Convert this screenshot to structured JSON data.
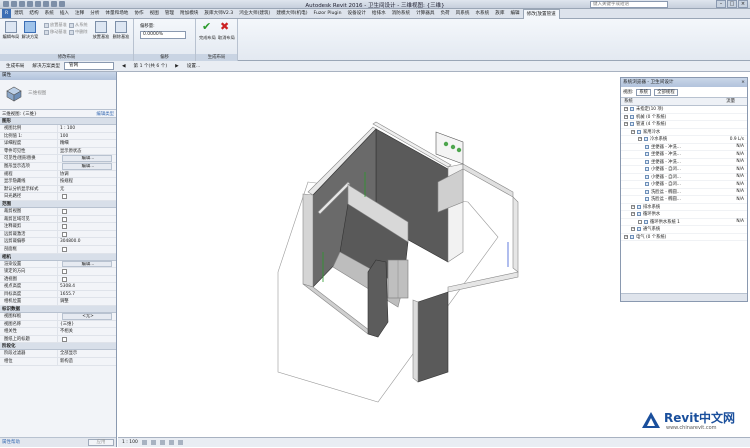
{
  "titlebar": {
    "app_title": "Autodesk Revit 2016 -   卫生间设计 - 三维视图: {三维}",
    "search_placeholder": "键入关键字或短语"
  },
  "tabs": [
    "建筑",
    "结构",
    "系统",
    "插入",
    "注释",
    "分析",
    "体量和场地",
    "协作",
    "视图",
    "管理",
    "附加模块",
    "族库大师V2.3",
    "鸿业大师(建筑)",
    "建模大师(机电)",
    "Fuzor Plugin",
    "设备设计",
    "给排水",
    "消防系统",
    "计算器具",
    "负荷",
    "风系统",
    "水系统",
    "族库",
    "编辑",
    "修改|放置管道"
  ],
  "ribbon": {
    "btn_edit": "编辑布局",
    "btn_solution": "解决方案",
    "btn_place_base": "放置基准",
    "btn_move_base": "移动基准",
    "btn_from_system": "从系统",
    "btn_to_center": "中删除",
    "btn_place": "放置基准",
    "btn_remove": "删除基准",
    "btn_modify": "修改",
    "btn_offset_label": "偏移量:",
    "offset_value": "0.0000%",
    "btn_finish": "完成布局",
    "btn_cancel": "取消布局",
    "panel_modify": "修改布局",
    "panel_offset": "偏移",
    "panel_generate": "生成布局"
  },
  "optionbar": {
    "generate_layout": "生成布局",
    "solution_type": "解决方案类型",
    "solution_value": "管网",
    "views": "第 1 个(共 6 个)",
    "settings": "设置..."
  },
  "properties": {
    "header": "属性",
    "type_name": "三维视图",
    "filter_label": "三维视图: {三维}",
    "edit_type": "编辑类型",
    "sections": [
      {
        "title": "图形",
        "rows": [
          [
            "视图比例",
            "1 : 100"
          ],
          [
            "比例值 1:",
            "100"
          ],
          [
            "详细程度",
            "精细"
          ],
          [
            "零件可见性",
            "显示原状态"
          ],
          [
            "可见性/图形替换",
            "编辑..."
          ],
          [
            "图形显示选项",
            "编辑..."
          ],
          [
            "规程",
            "协调"
          ],
          [
            "显示隐藏线",
            "按规程"
          ],
          [
            "默认分析显示样式",
            "无"
          ],
          [
            "日光路径",
            ""
          ]
        ]
      },
      {
        "title": "范围",
        "rows": [
          [
            "裁剪视图",
            ""
          ],
          [
            "裁剪区域可见",
            ""
          ],
          [
            "注释裁剪",
            ""
          ],
          [
            "远剪裁激活",
            ""
          ],
          [
            "远剪裁偏移",
            "304800.0"
          ],
          [
            "剖面框",
            ""
          ]
        ]
      },
      {
        "title": "相机",
        "rows": [
          [
            "渲染设置",
            "编辑..."
          ],
          [
            "锁定的方向",
            ""
          ],
          [
            "透视图",
            ""
          ],
          [
            "视点高度",
            "5308.4"
          ],
          [
            "目标高度",
            "1655.7"
          ],
          [
            "相机位置",
            "调整"
          ]
        ]
      },
      {
        "title": "标识数据",
        "rows": [
          [
            "视图样板",
            "<无>"
          ],
          [
            "视图名称",
            "{三维}"
          ],
          [
            "相关性",
            "不相关"
          ],
          [
            "图纸上的标题",
            ""
          ]
        ]
      },
      {
        "title": "阶段化",
        "rows": [
          [
            "阶段过滤器",
            "全部显示"
          ],
          [
            "相位",
            "新构造"
          ]
        ]
      }
    ],
    "help_link": "属性帮助",
    "apply": "应用"
  },
  "statusbar": {
    "scale": "1 : 100"
  },
  "system_browser": {
    "title": "系统浏览器 - 卫生间设计",
    "view_label": "视图:",
    "view_value": "系统",
    "filter_value": "全部规程",
    "col_system": "系统",
    "col_flow": "流量",
    "tree": [
      {
        "indent": 0,
        "label": "未指定(10 项)",
        "flow": ""
      },
      {
        "indent": 0,
        "label": "机械 (0 个系统)",
        "flow": ""
      },
      {
        "indent": 0,
        "label": "管道 (4 个系统)",
        "flow": ""
      },
      {
        "indent": 1,
        "label": "家用冷水",
        "flow": ""
      },
      {
        "indent": 2,
        "label": "冷水系统",
        "flow": "0.9 L/s"
      },
      {
        "indent": 3,
        "label": "坐便器 - 冲洗...",
        "flow": "N/A"
      },
      {
        "indent": 3,
        "label": "坐便器 - 冲洗...",
        "flow": "N/A"
      },
      {
        "indent": 3,
        "label": "坐便器 - 冲洗...",
        "flow": "N/A"
      },
      {
        "indent": 3,
        "label": "小便器 - 自闭...",
        "flow": "N/A"
      },
      {
        "indent": 3,
        "label": "小便器 - 自闭...",
        "flow": "N/A"
      },
      {
        "indent": 3,
        "label": "小便器 - 自闭...",
        "flow": "N/A"
      },
      {
        "indent": 3,
        "label": "洗脸盆 - 椭圆...",
        "flow": "N/A"
      },
      {
        "indent": 3,
        "label": "洗脸盆 - 椭圆...",
        "flow": "N/A"
      },
      {
        "indent": 1,
        "label": "排水系统",
        "flow": ""
      },
      {
        "indent": 1,
        "label": "循环供水",
        "flow": ""
      },
      {
        "indent": 2,
        "label": "循环供水系统 1",
        "flow": "N/A"
      },
      {
        "indent": 1,
        "label": "通气系统",
        "flow": ""
      },
      {
        "indent": 0,
        "label": "电气 (0 个系统)",
        "flow": ""
      }
    ]
  },
  "watermark": {
    "title": "Revit中文网",
    "url": "www.chinarevit.com"
  },
  "colors": {
    "accent": "#3c6eb4",
    "ok": "#2b9a2b",
    "cancel": "#cc2222",
    "wall_dark": "#5a5a5a",
    "wall_light": "#e8e8e8"
  }
}
